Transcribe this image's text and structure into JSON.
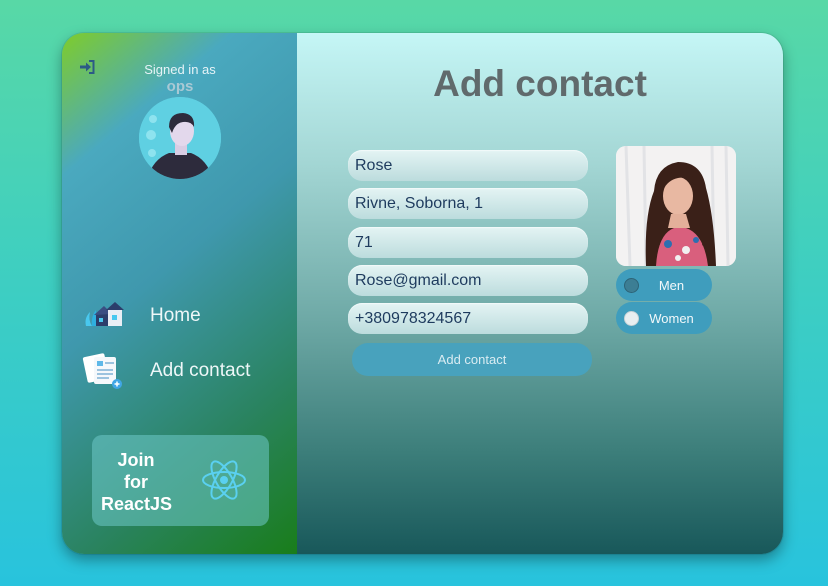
{
  "sidebar": {
    "signed_in_label": "Signed in as",
    "username": "ops",
    "nav": [
      {
        "label": "Home",
        "icon": "house-icon"
      },
      {
        "label": "Add contact",
        "icon": "contacts-add-icon"
      }
    ],
    "join": {
      "line1": "Join",
      "line2": "for",
      "line3": "ReactJS",
      "icon": "react-logo-icon"
    }
  },
  "main": {
    "title": "Add contact",
    "fields": {
      "name": "Rose",
      "address": "Rivne, Soborna, 1",
      "age": "71",
      "email": "Rose@gmail.com",
      "phone": "+380978324567"
    },
    "submit_label": "Add contact",
    "gender": {
      "options": [
        {
          "label": "Men",
          "checked": true
        },
        {
          "label": "Women",
          "checked": false
        }
      ]
    }
  },
  "colors": {
    "page_bg": "#3fcfc0",
    "accent": "#48a2bd",
    "title": "#606a6c"
  }
}
